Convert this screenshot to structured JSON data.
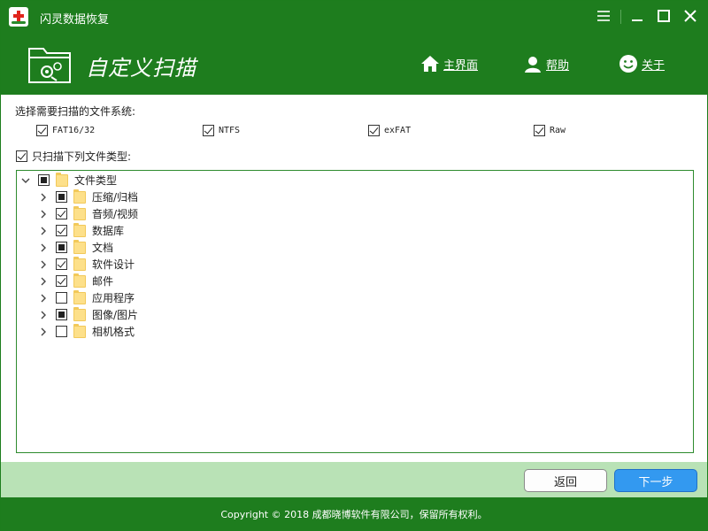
{
  "window": {
    "title": "闪灵数据恢复",
    "accent_color": "#1e7d1e",
    "controls": [
      "menu-icon",
      "minimize-icon",
      "maximize-icon",
      "close-icon"
    ]
  },
  "header": {
    "page_title": "自定义扫描",
    "nav": {
      "home": "主界面",
      "help": "帮助",
      "about": "关于"
    }
  },
  "filesystems": {
    "label": "选择需要扫描的文件系统:",
    "options": [
      {
        "label": "FAT16/32",
        "checked": true
      },
      {
        "label": "NTFS",
        "checked": true
      },
      {
        "label": "exFAT",
        "checked": true
      },
      {
        "label": "Raw",
        "checked": true
      }
    ]
  },
  "only_scan": {
    "label": "只扫描下列文件类型:",
    "checked": true
  },
  "tree": {
    "root": {
      "label": "文件类型",
      "state": "partial",
      "expanded": true
    },
    "items": [
      {
        "label": "压缩/归档",
        "state": "partial"
      },
      {
        "label": "音频/视频",
        "state": "checked"
      },
      {
        "label": "数据库",
        "state": "checked"
      },
      {
        "label": "文档",
        "state": "partial"
      },
      {
        "label": "软件设计",
        "state": "checked"
      },
      {
        "label": "邮件",
        "state": "checked"
      },
      {
        "label": "应用程序",
        "state": "unchecked"
      },
      {
        "label": "图像/图片",
        "state": "partial"
      },
      {
        "label": "相机格式",
        "state": "unchecked"
      }
    ]
  },
  "buttons": {
    "back": "返回",
    "next": "下一步"
  },
  "footer": {
    "copyright": "Copyright © 2018 成都晓博软件有限公司，保留所有权利。"
  }
}
